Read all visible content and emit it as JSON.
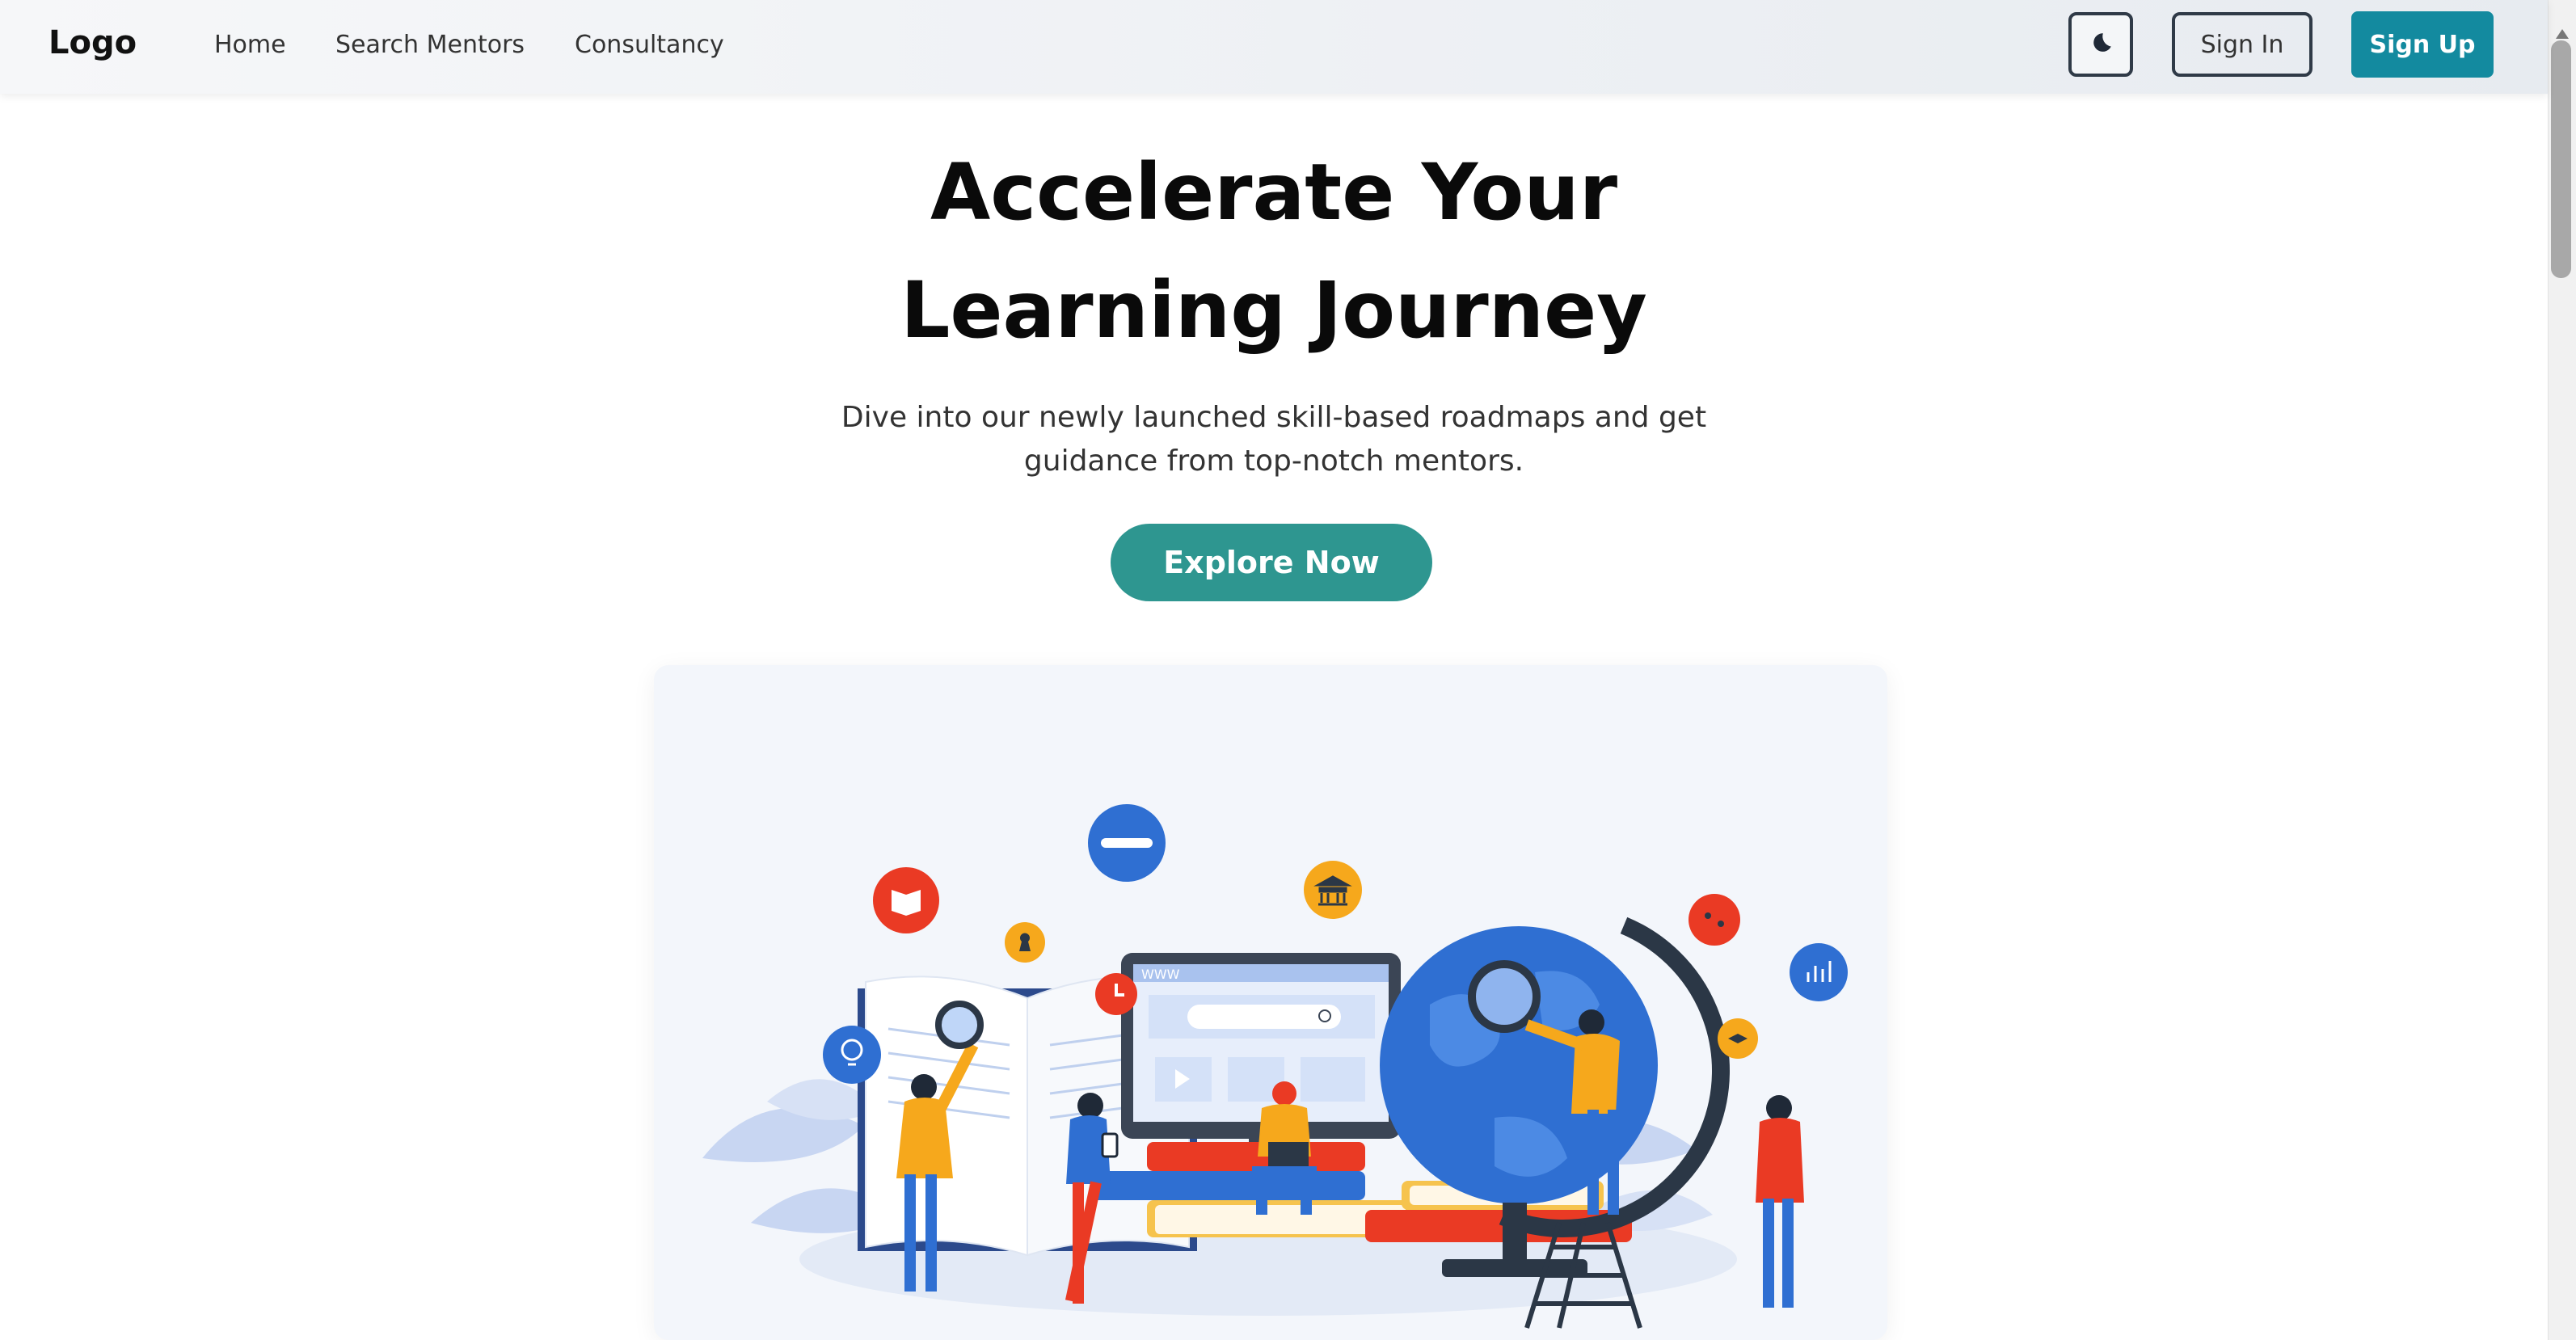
{
  "navbar": {
    "logo": "Logo",
    "links": [
      "Home",
      "Search Mentors",
      "Consultancy"
    ],
    "theme_toggle_icon": "moon-icon",
    "sign_in_label": "Sign In",
    "sign_up_label": "Sign Up"
  },
  "hero": {
    "title_line1": "Accelerate Your",
    "title_line2": "Learning Journey",
    "subtitle_line1": "Dive into our newly launched skill-based roadmaps and get",
    "subtitle_line2": "guidance from top-notch mentors.",
    "cta_label": "Explore Now"
  },
  "illustration": {
    "browser_url_text": "WWW"
  },
  "colors": {
    "brand_teal": "#138a9f",
    "cta_teal": "#2e9690",
    "nav_border": "#2f3a47"
  }
}
